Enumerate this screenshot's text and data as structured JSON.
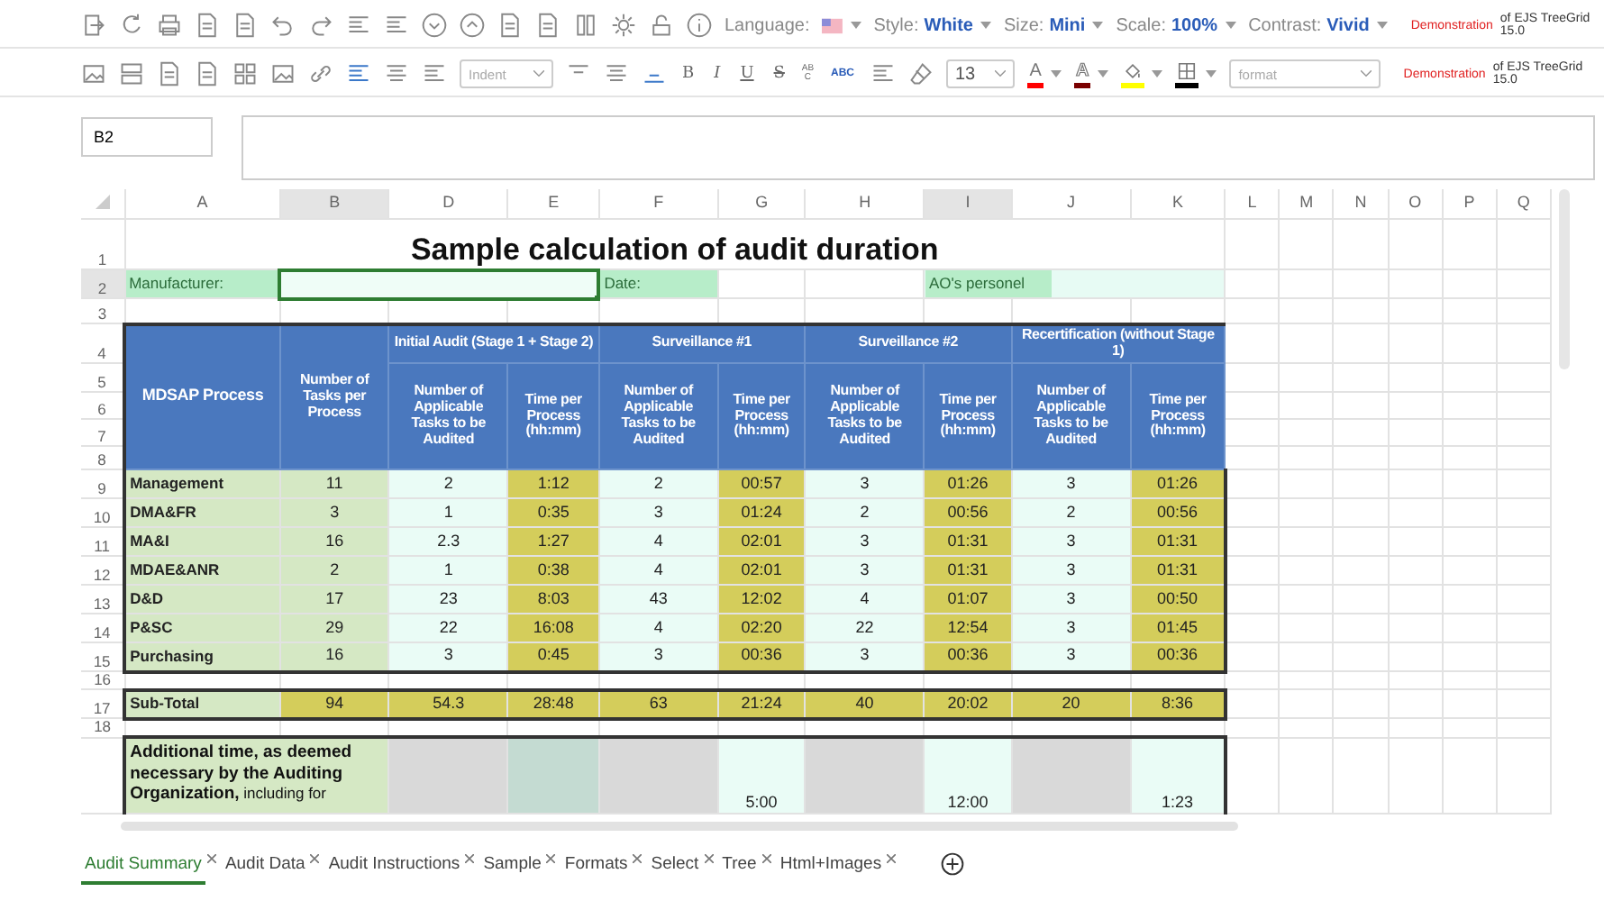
{
  "toolbar": {
    "language": {
      "label": "Language:"
    },
    "settings": [
      {
        "label": "Style:",
        "value": "White"
      },
      {
        "label": "Size:",
        "value": "Mini"
      },
      {
        "label": "Scale:",
        "value": "100%"
      },
      {
        "label": "Contrast:",
        "value": "Vivid"
      }
    ],
    "notice": {
      "highlight": "Demonstration",
      "rest": "of EJS TreeGrid 15.0"
    }
  },
  "format_bar": {
    "indent_placeholder": "Indent",
    "text_buttons": [
      {
        "kind": "bold",
        "label": "B"
      },
      {
        "kind": "italic",
        "label": "I"
      },
      {
        "kind": "underline",
        "label": "U"
      },
      {
        "kind": "strike",
        "label": "S"
      },
      {
        "kind": "vertical",
        "label": "ABC"
      },
      {
        "kind": "horizontal",
        "label": "ABC"
      }
    ],
    "font_size": "13",
    "color_buttons": [
      {
        "kind": "letter",
        "label": "A",
        "color": "#ff0000"
      },
      {
        "kind": "letter-outline",
        "label": "A",
        "color": "#7a0000"
      },
      {
        "kind": "fill",
        "color": "#ffff00"
      },
      {
        "kind": "border",
        "color": "#000000"
      }
    ],
    "format_placeholder": "format",
    "notice": {
      "highlight": "Demonstration",
      "rest": "of EJS TreeGrid 15.0"
    }
  },
  "formula_bar": {
    "cell_ref": "B2"
  },
  "columns": [
    {
      "label": "A",
      "selected": false
    },
    {
      "label": "B",
      "selected": true
    },
    {
      "label": "D",
      "selected": false
    },
    {
      "label": "E",
      "selected": false
    },
    {
      "label": "F",
      "selected": false
    },
    {
      "label": "G",
      "selected": false
    },
    {
      "label": "H",
      "selected": false
    },
    {
      "label": "I",
      "selected": true
    },
    {
      "label": "J",
      "selected": false
    },
    {
      "label": "K",
      "selected": false
    },
    {
      "label": "L",
      "selected": false
    },
    {
      "label": "M",
      "selected": false
    },
    {
      "label": "N",
      "selected": false
    },
    {
      "label": "O",
      "selected": false
    },
    {
      "label": "P",
      "selected": false
    },
    {
      "label": "Q",
      "selected": false
    }
  ],
  "rows": [
    {
      "number": "1",
      "selected": false,
      "kind": "title",
      "text": "Sample calculation of audit duration"
    },
    {
      "number": "2",
      "selected": true,
      "kind": "fields",
      "manufacturer_label": "Manufacturer:",
      "date_label": "Date:",
      "personnel_label": "AO's personel"
    },
    {
      "number": "3",
      "selected": false,
      "kind": "empty"
    },
    {
      "number": "4",
      "selected": false,
      "kind": "header",
      "process": "MDSAP Process",
      "tasks": "Number of Tasks per Process",
      "groups": [
        "Initial Audit (Stage 1 + Stage 2)",
        "Surveillance #1",
        "Surveillance #2",
        "Recertification (without Stage 1)"
      ]
    },
    {
      "number": "5",
      "selected": false,
      "kind": "subheader",
      "cells": [
        "Number of Applicable Tasks to be Audited",
        "Time per Process (hh:mm)",
        "Number of Applicable Tasks to be Audited",
        "Time per Process (hh:mm)",
        "Number of Applicable Tasks to be Audited",
        "Time per Process (hh:mm)",
        "Number of Applicable Tasks to be Audited",
        "Time per Process (hh:mm)"
      ]
    },
    {
      "number": "6",
      "selected": false,
      "kind": "covered"
    },
    {
      "number": "7",
      "selected": false,
      "kind": "covered"
    },
    {
      "number": "8",
      "selected": false,
      "kind": "covered"
    },
    {
      "number": "9",
      "selected": false,
      "kind": "data",
      "name": "Management",
      "values": [
        "11",
        "2",
        "1:12",
        "2",
        "00:57",
        "3",
        "01:26",
        "3",
        "01:26"
      ]
    },
    {
      "number": "10",
      "selected": false,
      "kind": "data",
      "name": "DMA&FR",
      "values": [
        "3",
        "1",
        "0:35",
        "3",
        "01:24",
        "2",
        "00:56",
        "2",
        "00:56"
      ]
    },
    {
      "number": "11",
      "selected": false,
      "kind": "data",
      "name": "MA&I",
      "values": [
        "16",
        "2.3",
        "1:27",
        "4",
        "02:01",
        "3",
        "01:31",
        "3",
        "01:31"
      ]
    },
    {
      "number": "12",
      "selected": false,
      "kind": "data",
      "name": "MDAE&ANR",
      "values": [
        "2",
        "1",
        "0:38",
        "4",
        "02:01",
        "3",
        "01:31",
        "3",
        "01:31"
      ]
    },
    {
      "number": "13",
      "selected": false,
      "kind": "data",
      "name": "D&D",
      "values": [
        "17",
        "23",
        "8:03",
        "43",
        "12:02",
        "4",
        "01:07",
        "3",
        "00:50"
      ]
    },
    {
      "number": "14",
      "selected": false,
      "kind": "data",
      "name": "P&SC",
      "values": [
        "29",
        "22",
        "16:08",
        "4",
        "02:20",
        "22",
        "12:54",
        "3",
        "01:45"
      ]
    },
    {
      "number": "15",
      "selected": false,
      "kind": "data",
      "name": "Purchasing",
      "values": [
        "16",
        "3",
        "0:45",
        "3",
        "00:36",
        "3",
        "00:36",
        "3",
        "00:36"
      ]
    },
    {
      "number": "16",
      "selected": false,
      "kind": "empty"
    },
    {
      "number": "17",
      "selected": false,
      "kind": "subtotal",
      "name": "Sub-Total",
      "values": [
        "94",
        "54.3",
        "28:48",
        "63",
        "21:24",
        "40",
        "20:02",
        "20",
        "8:36"
      ]
    },
    {
      "number": "18",
      "selected": false,
      "kind": "empty"
    },
    {
      "number": "",
      "selected": false,
      "kind": "additional",
      "text": "**Additional time, as deemed necessary by the Auditing Organization,** including for",
      "cells": [
        {
          "kind": "blank"
        },
        {
          "kind": "blank"
        },
        {
          "kind": "blank"
        },
        {
          "kind": "value",
          "value": "5:00"
        },
        {
          "kind": "blank"
        },
        {
          "kind": "value",
          "value": "12:00"
        },
        {
          "kind": "blank"
        },
        {
          "kind": "value",
          "value": "1:23"
        }
      ]
    }
  ],
  "sheet_tabs": [
    {
      "label": "Audit Summary",
      "selected": true
    },
    {
      "label": "Audit Data",
      "selected": false
    },
    {
      "label": "Audit Instructions",
      "selected": false
    },
    {
      "label": "Sample",
      "selected": false
    },
    {
      "label": "Formats",
      "selected": false
    },
    {
      "label": "Select",
      "selected": false
    },
    {
      "label": "Tree",
      "selected": false
    },
    {
      "label": "Html+Images",
      "selected": false
    }
  ]
}
